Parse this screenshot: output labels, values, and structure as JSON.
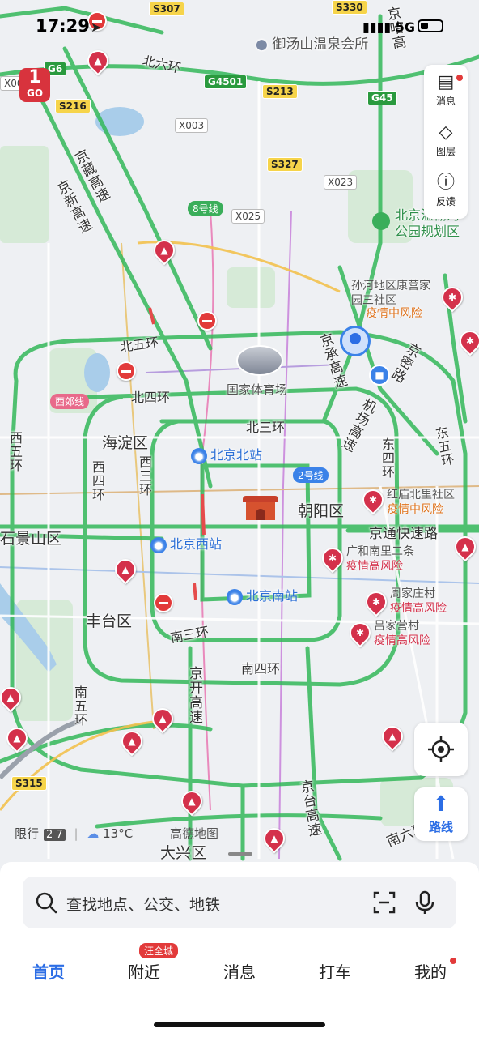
{
  "status_bar": {
    "time": "17:29",
    "network": "5G"
  },
  "map": {
    "districts": [
      "海淀区",
      "朝阳区",
      "丰台区",
      "大兴区",
      "石景山区"
    ],
    "rings": [
      "北六环",
      "北五环",
      "北四环",
      "北三环",
      "南三环",
      "南四环",
      "南五环",
      "西五环",
      "西四环",
      "西三环",
      "东四环",
      "东五环"
    ],
    "roads": [
      "京藏高速",
      "京新高速",
      "京承高速",
      "机场高速",
      "京密路",
      "京通快速路",
      "京开高速",
      "京台高速",
      "西郊线",
      "南六环",
      "京哈高"
    ],
    "shields": [
      "S307",
      "S330",
      "G6",
      "S216",
      "G4501",
      "S213",
      "G45",
      "S327",
      "S315",
      "X003",
      "X023",
      "X025",
      "X00"
    ],
    "metro_lines": [
      "8号线",
      "2号线"
    ],
    "places": [
      "御汤山温泉会所",
      "国家体育场",
      "北京温榆河公园规划区"
    ],
    "stations": [
      "北京北站",
      "北京西站",
      "北京南站"
    ],
    "risk_areas": [
      {
        "name": "孙河地区康营家园三社区",
        "risk": "疫情中风险"
      },
      {
        "name": "红庙北里社区",
        "risk": "疫情中风险"
      },
      {
        "name": "广和南里二条",
        "risk": "疫情高风险"
      },
      {
        "name": "周家庄村",
        "risk": "疫情高风险"
      },
      {
        "name": "吕家营村",
        "risk": "疫情高风险"
      }
    ],
    "badge_go": "GO"
  },
  "tools": {
    "messages": "消息",
    "layers": "图层",
    "feedback": "反馈"
  },
  "locate_icon": "crosshair-icon",
  "route_label": "路线",
  "weather": {
    "restriction_label": "限行",
    "plates": "2 7",
    "temperature": "13°C"
  },
  "brand": "高德地图",
  "search": {
    "placeholder": "查找地点、公交、地铁"
  },
  "tabs": {
    "home": "首页",
    "nearby": "附近",
    "messages": "消息",
    "taxi": "打车",
    "mine": "我的",
    "nearby_badge": "汪全城"
  },
  "colors": {
    "accent": "#2b6de5",
    "road_green": "#34b85a",
    "risk_red": "#d4314b",
    "risk_orange": "#e0731c"
  }
}
